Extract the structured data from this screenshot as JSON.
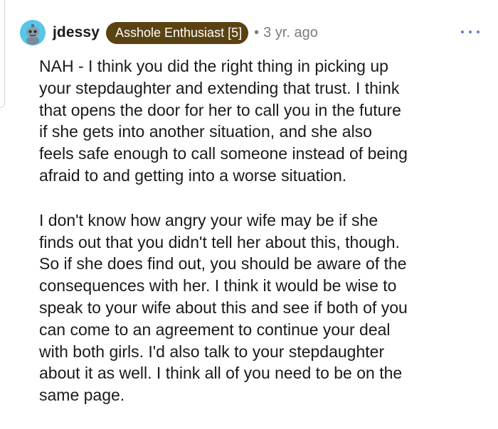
{
  "comment": {
    "username": "jdessy",
    "flair": "Asshole Enthusiast [5]",
    "separator": "•",
    "timestamp": "3 yr. ago",
    "menu_icon": "more-options-icon",
    "avatar_color": "#57c6e8",
    "flair_color": "#5b4212",
    "paragraphs": [
      "NAH - I think you did the right thing in picking up\nyour stepdaughter and extending that trust. I think\nthat opens the door for her to call you in the future\nif she gets into another situation, and she also\nfeels safe enough to call someone instead of being\nafraid to and getting into a worse situation.",
      "I don't know how angry your wife may be if she\nfinds out that you didn't tell her about this, though.\nSo if she does find out, you should be aware of the\nconsequences with her. I think it would be wise to\nspeak to your wife about this and see if both of you\ncan come to an agreement to continue your deal\nwith both girls. I'd also talk to your stepdaughter\nabout it as well. I think all of you need to be on the\nsame page."
    ]
  }
}
